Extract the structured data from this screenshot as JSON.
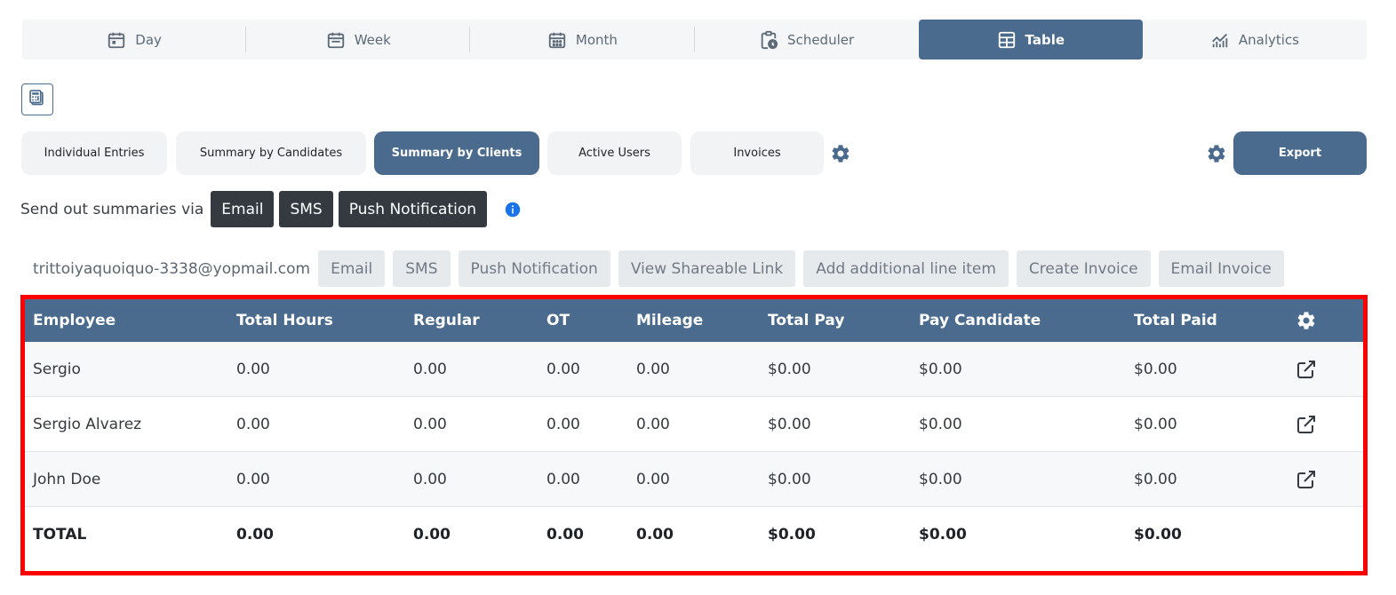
{
  "view_tabs": [
    {
      "label": "Day",
      "icon": "calendar-day-icon"
    },
    {
      "label": "Week",
      "icon": "calendar-week-icon"
    },
    {
      "label": "Month",
      "icon": "calendar-month-icon"
    },
    {
      "label": "Scheduler",
      "icon": "clipboard-clock-icon"
    },
    {
      "label": "Table",
      "icon": "table-icon"
    },
    {
      "label": "Analytics",
      "icon": "chart-icon"
    }
  ],
  "report_tabs": [
    {
      "label": "Individual Entries"
    },
    {
      "label": "Summary by Candidates"
    },
    {
      "label": "Summary by Clients"
    },
    {
      "label": "Active Users"
    },
    {
      "label": "Invoices"
    }
  ],
  "export_label": "Export",
  "send_summaries": {
    "label": "Send out summaries via",
    "email": "Email",
    "sms": "SMS",
    "push": "Push Notification"
  },
  "client": {
    "email": "trittoiyaquoiquo-3338@yopmail.com",
    "actions": [
      "Email",
      "SMS",
      "Push Notification",
      "View Shareable Link",
      "Add additional line item",
      "Create Invoice",
      "Email Invoice"
    ]
  },
  "table": {
    "columns": [
      "Employee",
      "Total Hours",
      "Regular",
      "OT",
      "Mileage",
      "Total Pay",
      "Pay Candidate",
      "Total Paid"
    ],
    "rows": [
      [
        "Sergio",
        "0.00",
        "0.00",
        "0.00",
        "0.00",
        "$0.00",
        "$0.00",
        "$0.00"
      ],
      [
        "Sergio Alvarez",
        "0.00",
        "0.00",
        "0.00",
        "0.00",
        "$0.00",
        "$0.00",
        "$0.00"
      ],
      [
        "John Doe",
        "0.00",
        "0.00",
        "0.00",
        "0.00",
        "$0.00",
        "$0.00",
        "$0.00"
      ]
    ],
    "total": [
      "TOTAL",
      "0.00",
      "0.00",
      "0.00",
      "0.00",
      "$0.00",
      "$0.00",
      "$0.00"
    ]
  },
  "colors": {
    "accent": "#4a6b8e",
    "dark_button": "#343a40",
    "highlight_border": "#ff0000",
    "info": "#1a73e8"
  }
}
